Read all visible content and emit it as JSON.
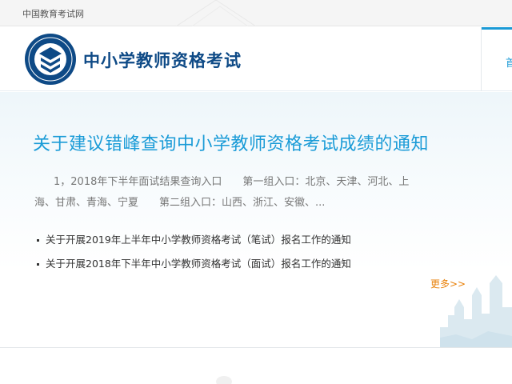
{
  "topbar": {
    "site_link": "中国教育考试网"
  },
  "header": {
    "title": "中小学教师资格考试",
    "nav_partial_char": "首"
  },
  "main": {
    "headline": "关于建议错峰查询中小学教师资格考试成绩的通知",
    "summary_line1": "1，2018年下半年面试结果查询入口　　第一组入口：北京、天津、河北、上",
    "summary_line2": "海、甘肃、青海、宁夏　　第二组入口：山西、浙江、安徽、...",
    "news": [
      "关于开展2019年上半年中小学教师资格考试（笔试）报名工作的通知",
      "关于开展2018年下半年中小学教师资格考试（面试）报名工作的通知"
    ],
    "more_label": "更多>>"
  },
  "colors": {
    "brand_dark": "#0e4a86",
    "headline": "#1a9bd7",
    "more": "#e8820c"
  }
}
